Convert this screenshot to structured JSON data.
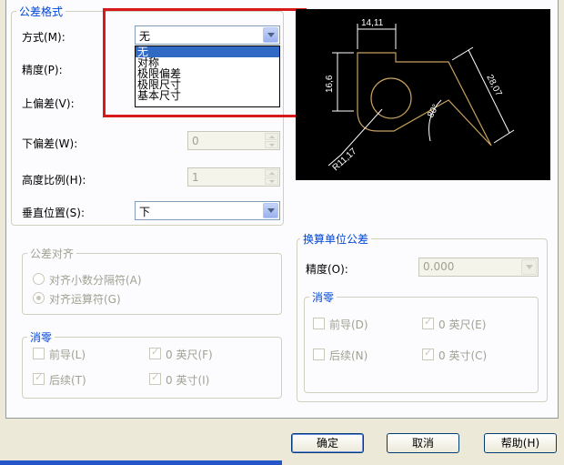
{
  "tolerance_format": {
    "title": "公差格式",
    "method_label": "方式(M):",
    "method_value": "无",
    "method_options": [
      "无",
      "对称",
      "极限偏差",
      "极限尺寸",
      "基本尺寸"
    ],
    "precision_label": "精度(P):",
    "upper_label": "上偏差(V):",
    "lower_label": "下偏差(W):",
    "lower_value": "0",
    "height_label": "高度比例(H):",
    "height_value": "1",
    "vpos_label": "垂直位置(S):",
    "vpos_value": "下"
  },
  "tolerance_align": {
    "title": "公差对齐",
    "option1": "对齐小数分隔符(A)",
    "option2": "对齐运算符(G)"
  },
  "zero_left": {
    "title": "消零",
    "leading": "前导(L)",
    "trailing": "后续(T)",
    "feet": "0 英尺(F)",
    "inches": "0 英寸(I)"
  },
  "alt_units": {
    "title": "换算单位公差",
    "precision_label": "精度(O):",
    "precision_value": "0.000",
    "zero_title": "消零",
    "leading": "前导(D)",
    "trailing": "后续(N)",
    "feet": "0 英尺(E)",
    "inches": "0 英寸(C)"
  },
  "preview": {
    "dim_top": "14,11",
    "dim_left": "16,6",
    "dim_right": "28,07",
    "dim_angle": "80°",
    "dim_radius": "R11,17"
  },
  "buttons": {
    "ok": "确定",
    "cancel": "取消",
    "help": "帮助(H)"
  }
}
